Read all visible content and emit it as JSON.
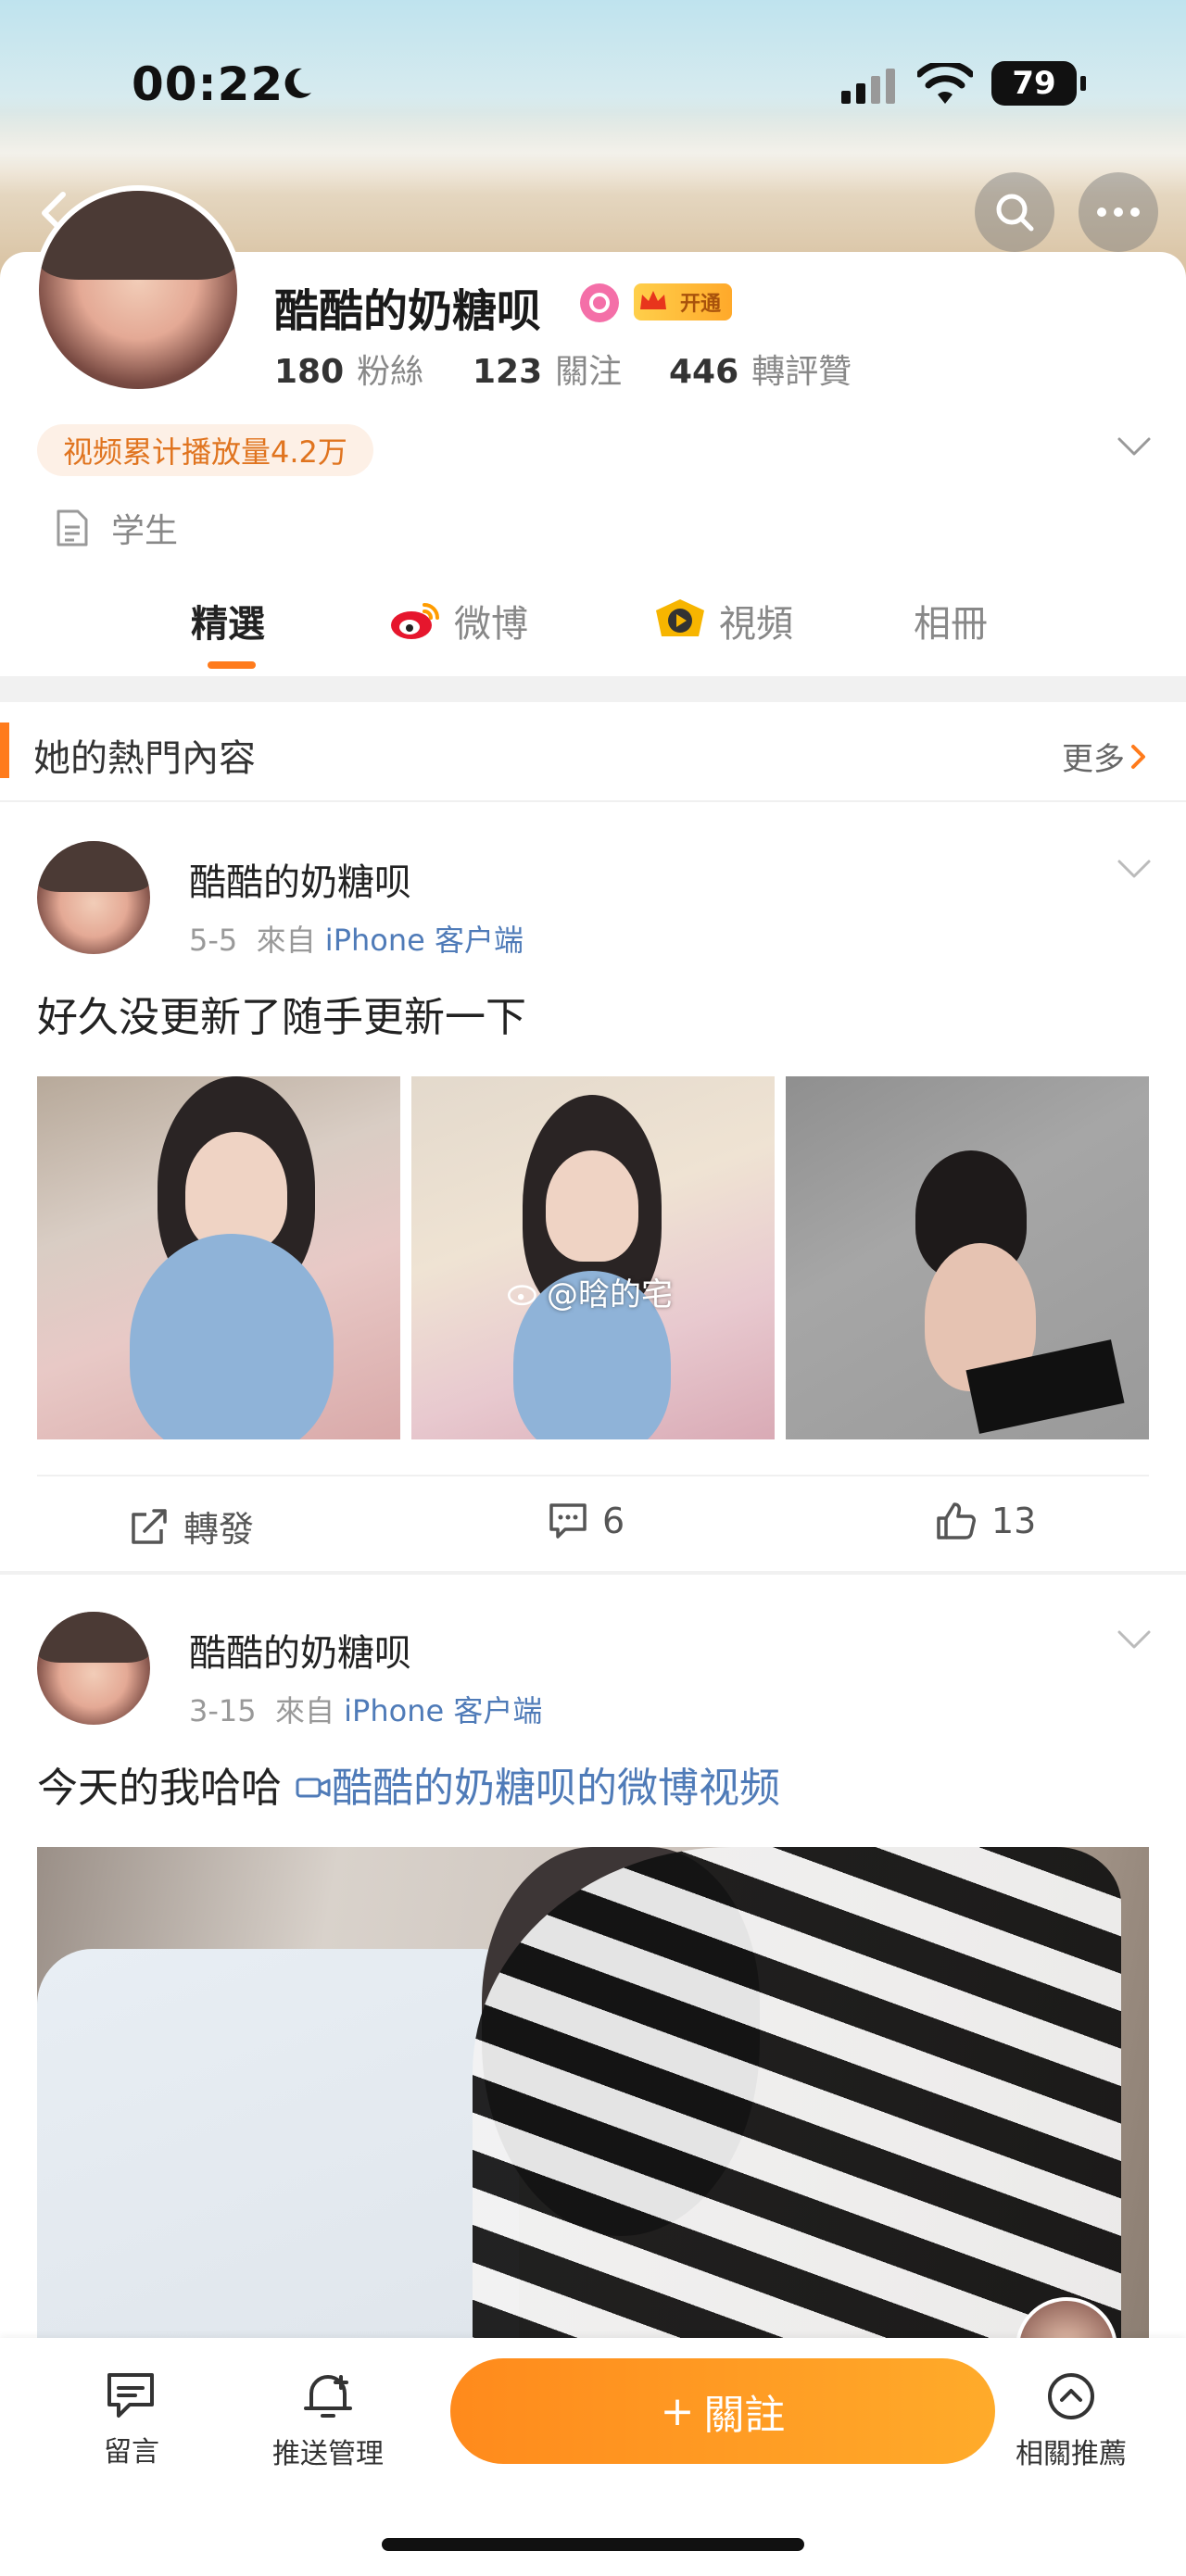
{
  "status_bar": {
    "time": "00:22",
    "battery": "79"
  },
  "profile": {
    "name": "酷酷的奶糖呗",
    "vip_label": "开通",
    "stats": [
      {
        "num": "180",
        "label": "粉絲"
      },
      {
        "num": "123",
        "label": "關注"
      },
      {
        "num": "446",
        "label": "轉評贊"
      }
    ],
    "play_count": "视频累计播放量4.2万",
    "occupation": "学生"
  },
  "tabs": [
    {
      "label": "精選",
      "active": true
    },
    {
      "label": "微博",
      "icon": "weibo-icon"
    },
    {
      "label": "視頻",
      "icon": "video-channel-icon"
    },
    {
      "label": "相冊"
    }
  ],
  "hot_section": {
    "title": "她的熱門內容",
    "more": "更多"
  },
  "posts": [
    {
      "author": "酷酷的奶糖呗",
      "date": "5-5",
      "from": "來自",
      "source": "iPhone 客户端",
      "text": "好久没更新了随手更新一下",
      "watermark": "@晗的宅",
      "actions": {
        "repost": "轉發",
        "comments": "6",
        "likes": "13"
      }
    },
    {
      "author": "酷酷的奶糖呗",
      "date": "3-15",
      "from": "來自",
      "source": "iPhone 客户端",
      "text": "今天的我哈哈",
      "link_text": "酷酷的奶糖呗的微博视频"
    }
  ],
  "bottom_bar": {
    "message": "留言",
    "push": "推送管理",
    "follow": "關註",
    "follow_plus": "+",
    "related": "相關推薦"
  },
  "colors": {
    "accent": "#ff7b1c",
    "link": "#4f7bb8",
    "vip": "#ffb22a",
    "badge_pink": "#f46fa8"
  }
}
